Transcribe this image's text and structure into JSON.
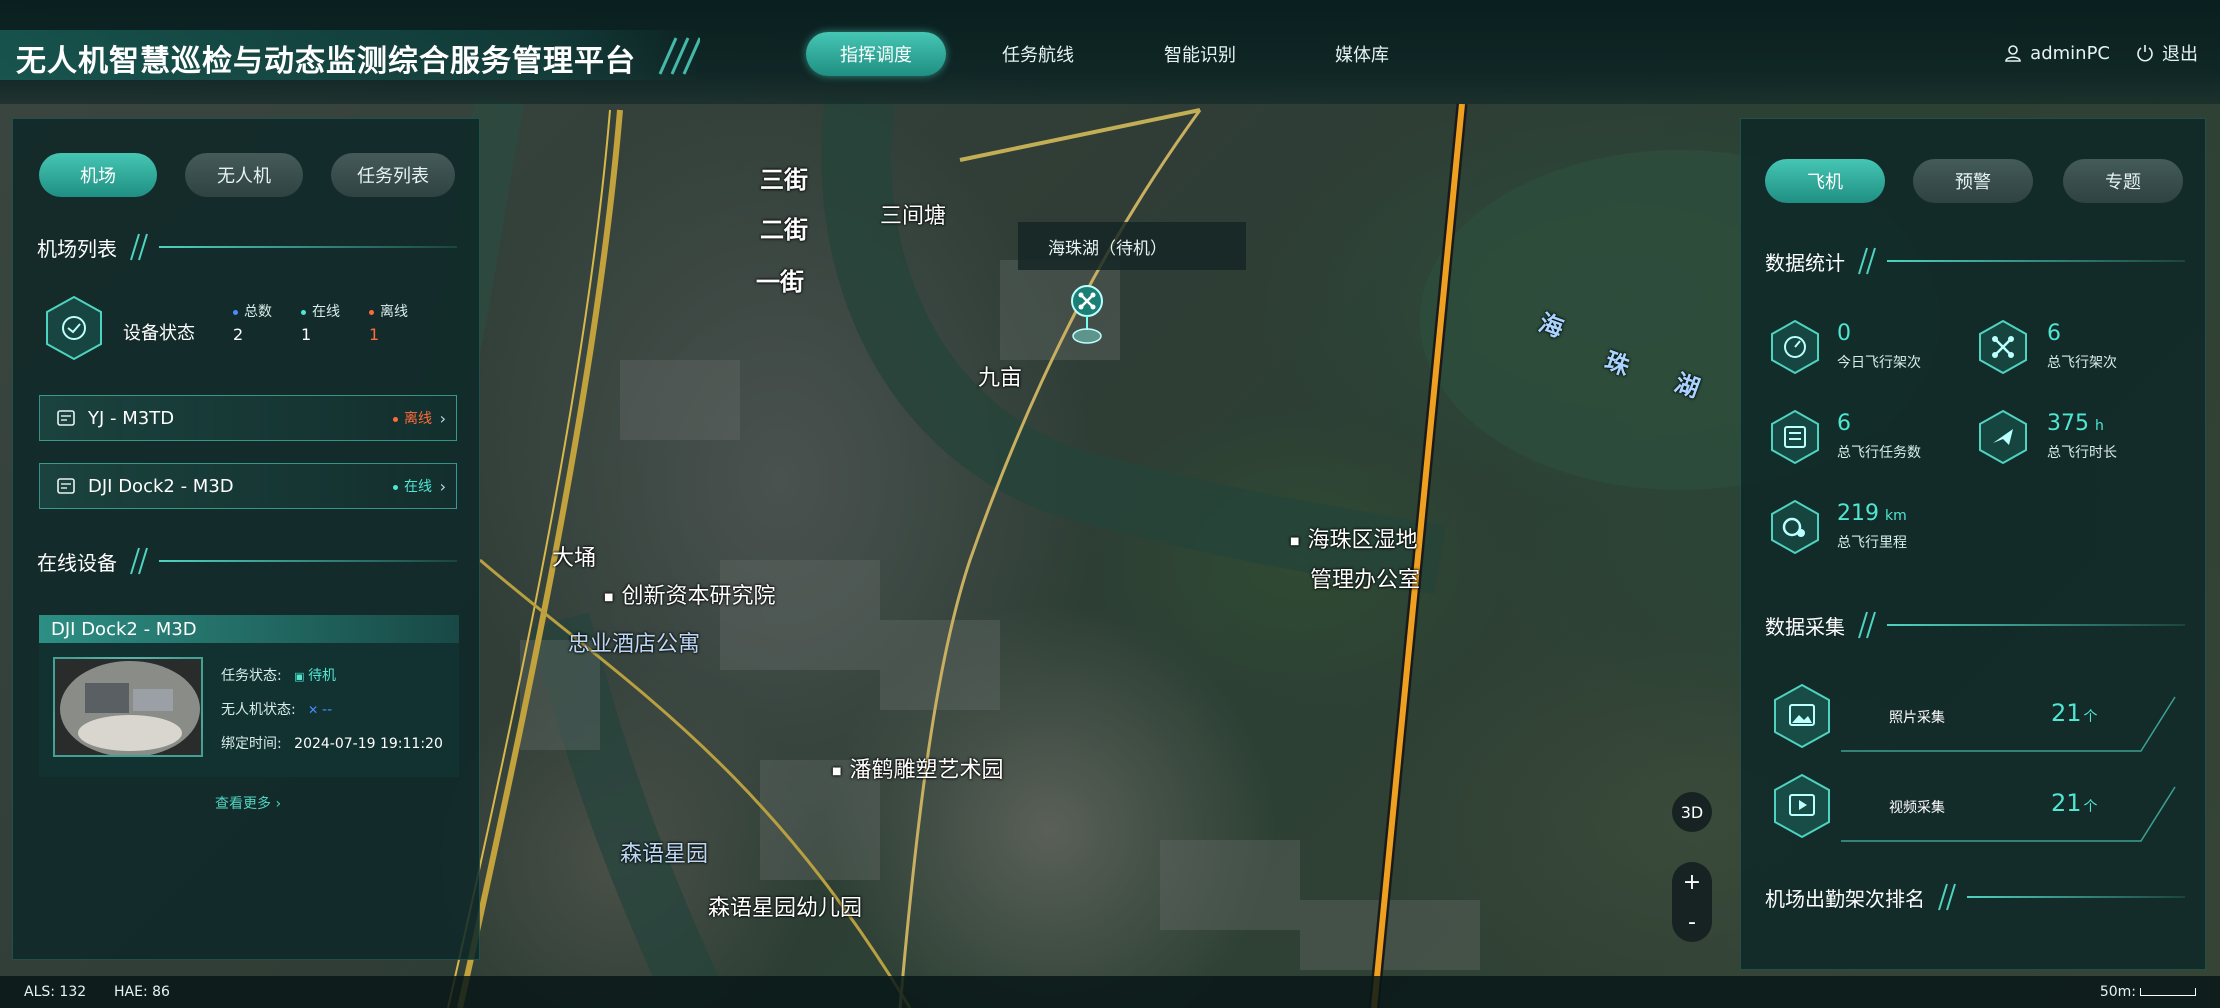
{
  "app": {
    "title": "无人机智慧巡检与动态监测综合服务管理平台"
  },
  "nav": {
    "tabs": [
      {
        "label": "指挥调度",
        "active": true
      },
      {
        "label": "任务航线",
        "active": false
      },
      {
        "label": "智能识别",
        "active": false
      },
      {
        "label": "媒体库",
        "active": false
      }
    ]
  },
  "user": {
    "username": "adminPC",
    "logout_label": "退出",
    "user_icon": "user-icon",
    "power_icon": "power-icon"
  },
  "left_panel": {
    "tabs": [
      {
        "label": "机场",
        "active": true
      },
      {
        "label": "无人机",
        "active": false
      },
      {
        "label": "任务列表",
        "active": false
      }
    ],
    "airport_list_title": "机场列表",
    "device_status": {
      "label": "设备状态",
      "total_label": "总数",
      "total_value": "2",
      "online_label": "在线",
      "online_value": "1",
      "offline_label": "离线",
      "offline_value": "1"
    },
    "docks": [
      {
        "name": "YJ - M3TD",
        "state": "离线",
        "state_color": "#ff6a3a"
      },
      {
        "name": "DJI Dock2 - M3D",
        "state": "在线",
        "state_color": "#4fe6d2"
      }
    ],
    "online_devices_title": "在线设备",
    "online_card": {
      "title": "DJI Dock2 - M3D",
      "task_status_label": "任务状态:",
      "task_status_value": "待机",
      "drone_status_label": "无人机状态:",
      "drone_status_value": "--",
      "bind_time_label": "绑定时间:",
      "bind_time_value": "2024-07-19 19:11:20"
    },
    "see_more": "查看更多"
  },
  "map": {
    "labels": {
      "street3": "三街",
      "street2": "二街",
      "street1": "一街",
      "sanjiantang": "三间塘",
      "jiumu": "九亩",
      "dayong": "大埇",
      "chuangxin": "创新资本研究院",
      "zhongye": "忠业酒店公寓",
      "wetland_office_1": "海珠区湿地",
      "wetland_office_2": "管理办公室",
      "panhe": "潘鹤雕塑艺术园",
      "senyu": "森语星园",
      "senyu_kg": "森语星园幼儿园",
      "lake_1": "海",
      "lake_2": "珠",
      "lake_3": "湖"
    },
    "popup": "海珠湖（待机）",
    "controls": {
      "mode_3d": "3D",
      "zoom_in": "+",
      "zoom_out": "-"
    }
  },
  "right_panel": {
    "tabs": [
      {
        "label": "飞机",
        "active": true
      },
      {
        "label": "预警",
        "active": false
      },
      {
        "label": "专题",
        "active": false
      }
    ],
    "data_stats_title": "数据统计",
    "stats": [
      {
        "value": "0",
        "unit": "",
        "label": "今日飞行架次",
        "icon": "gauge-icon"
      },
      {
        "value": "6",
        "unit": "",
        "label": "总飞行架次",
        "icon": "drone-icon"
      },
      {
        "value": "6",
        "unit": "",
        "label": "总飞行任务数",
        "icon": "task-list-icon"
      },
      {
        "value": "375",
        "unit": "h",
        "label": "总飞行时长",
        "icon": "plane-icon"
      },
      {
        "value": "219",
        "unit": "km",
        "label": "总飞行里程",
        "icon": "mileage-icon"
      }
    ],
    "data_collect_title": "数据采集",
    "collect": [
      {
        "label": "照片采集",
        "value": "21",
        "unit": "个",
        "icon": "photo-icon"
      },
      {
        "label": "视频采集",
        "value": "21",
        "unit": "个",
        "icon": "video-icon"
      }
    ],
    "ranking_title": "机场出勤架次排名"
  },
  "status_bar": {
    "als": "ALS: 132",
    "hae": "HAE: 86",
    "scale": "50m:"
  }
}
